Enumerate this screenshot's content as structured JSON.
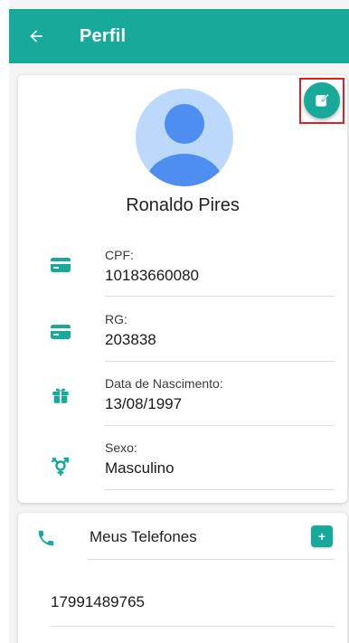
{
  "appbar": {
    "title": "Perfil"
  },
  "profile": {
    "name": "Ronaldo Pires",
    "fields": [
      {
        "label": "CPF:",
        "value": "10183660080",
        "icon": "id-card-icon"
      },
      {
        "label": "RG:",
        "value": "203838",
        "icon": "id-card-icon"
      },
      {
        "label": "Data de Nascimento:",
        "value": "13/08/1997",
        "icon": "gift-icon"
      },
      {
        "label": "Sexo:",
        "value": "Masculino",
        "icon": "gender-icon"
      }
    ]
  },
  "phones": {
    "title": "Meus Telefones",
    "add_label": "+",
    "items": [
      "17991489765"
    ]
  },
  "colors": {
    "primary": "#17a99a",
    "avatar_bg": "#bcd9fb",
    "avatar_fg": "#4e8ef0",
    "highlight_border": "#e02020"
  }
}
